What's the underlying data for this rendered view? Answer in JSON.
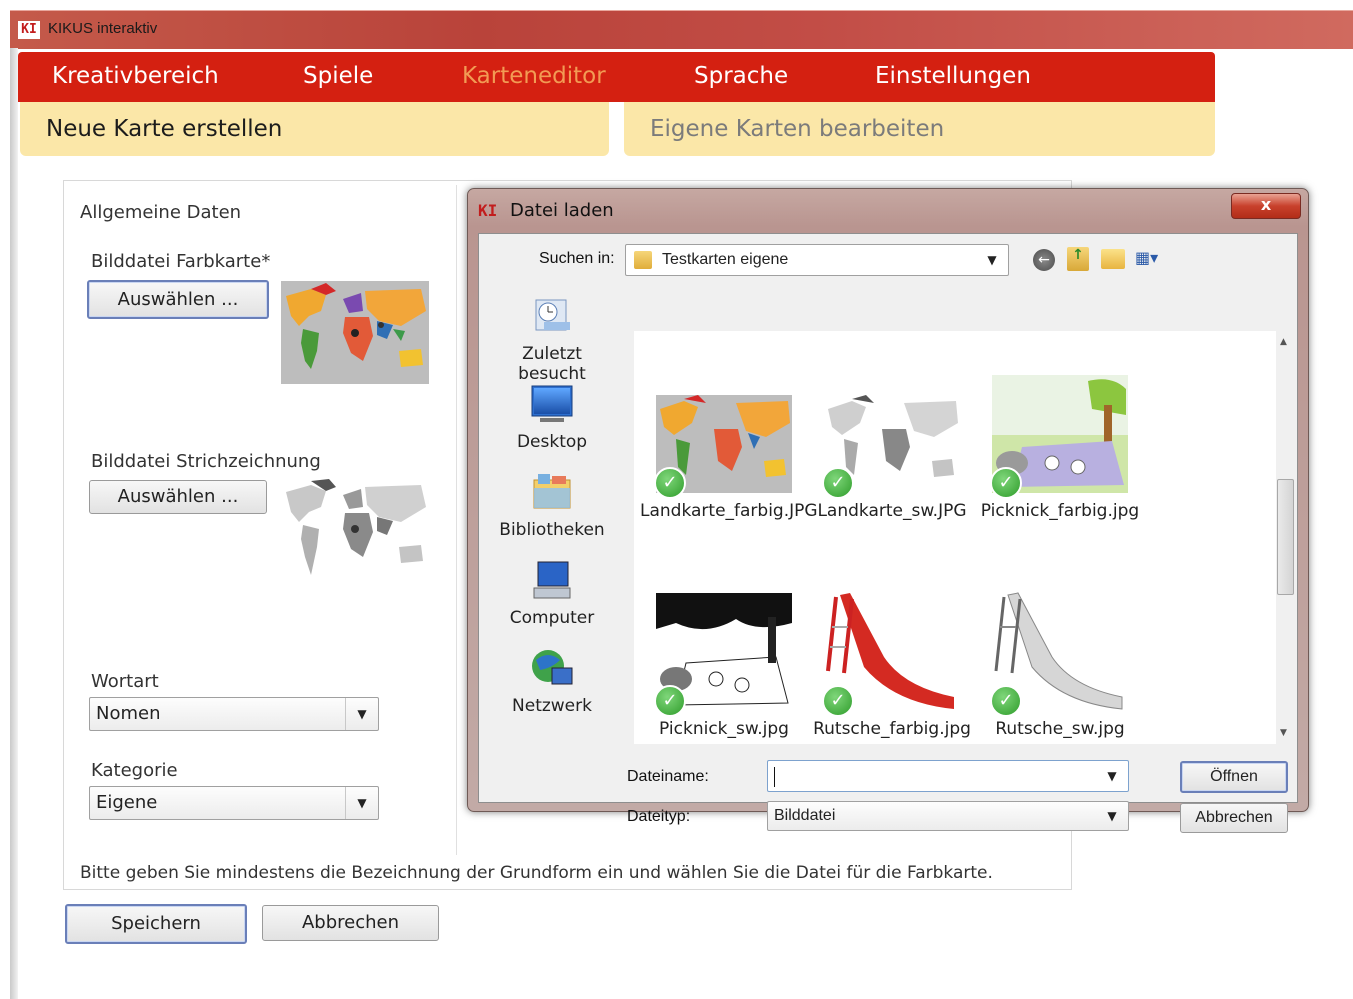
{
  "app": {
    "logo": "KI",
    "title": "KIKUS interaktiv"
  },
  "menu": {
    "items": [
      "Kreativbereich",
      "Spiele",
      "Karteneditor",
      "Sprache",
      "Einstellungen"
    ],
    "active": "Karteneditor",
    "color": "#d42011",
    "active_color": "#f29b54"
  },
  "subtabs": [
    "Neue Karte erstellen",
    "Eigene Karten bearbeiten"
  ],
  "form": {
    "section_title": "Allgemeine Daten",
    "color_file_label": "Bilddatei Farbkarte*",
    "line_file_label": "Bilddatei Strichzeichnung",
    "choose_label": "Auswählen ...",
    "wortart_label": "Wortart",
    "wortart_value": "Nomen",
    "kategorie_label": "Kategorie",
    "kategorie_value": "Eigene",
    "hint": "Bitte geben Sie mindestens die Bezeichnung der Grundform ein und wählen Sie die Datei für die Farbkarte.",
    "save_label": "Speichern",
    "cancel_label": "Abbrechen"
  },
  "dialog": {
    "logo": "KI",
    "title": "Datei laden",
    "close_label": "x",
    "lookin_label": "Suchen in:",
    "lookin_value": "Testkarten eigene",
    "places": [
      "Zuletzt besucht",
      "Desktop",
      "Bibliotheken",
      "Computer",
      "Netzwerk"
    ],
    "files": [
      {
        "name": "Landkarte_farbig.JPG",
        "kind": "map-color"
      },
      {
        "name": "Landkarte_sw.JPG",
        "kind": "map-gray"
      },
      {
        "name": "Picknick_farbig.jpg",
        "kind": "picnic-color"
      },
      {
        "name": "Picknick_sw.jpg",
        "kind": "picnic-bw"
      },
      {
        "name": "Rutsche_farbig.jpg",
        "kind": "slide-red"
      },
      {
        "name": "Rutsche_sw.jpg",
        "kind": "slide-gray"
      }
    ],
    "filename_label": "Dateiname:",
    "filename_value": "",
    "filetype_label": "Dateityp:",
    "filetype_value": "Bilddatei",
    "open_label": "Öffnen",
    "cancel_label": "Abbrechen"
  }
}
